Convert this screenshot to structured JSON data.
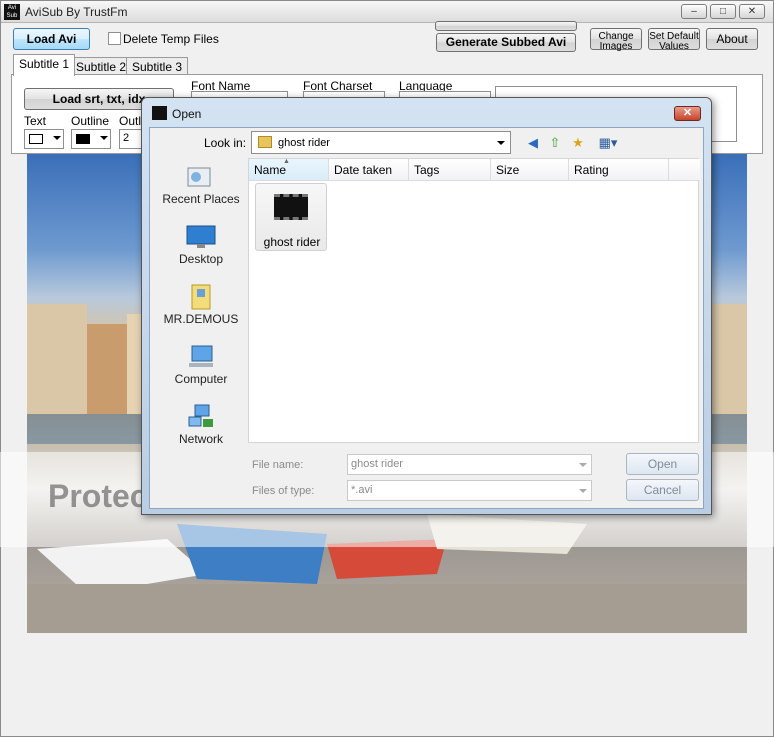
{
  "window": {
    "title": "AviSub By TrustFm",
    "icon_text": "Avi Sub",
    "controls": [
      "minimize",
      "maximize",
      "close"
    ]
  },
  "toolbar": {
    "load_avi": "Load Avi",
    "delete_temp": "Delete Temp Files",
    "delete_temp_checked": false,
    "generate": "Generate Subbed Avi",
    "change_images_1": "Change",
    "change_images_2": "Images",
    "set_default_1": "Set Default",
    "set_default_2": "Values",
    "about": "About"
  },
  "tabs": [
    "Subtitle 1",
    "Subtitle 2",
    "Subtitle 3"
  ],
  "active_tab": 0,
  "subtitle_panel": {
    "load_button": "Load srt, txt, idx",
    "font_name_label": "Font Name",
    "font_charset_label": "Font Charset",
    "language_label": "Language",
    "text_label": "Text",
    "outline_label_1": "Outline",
    "outline_label_2": "Outli",
    "outline_value": "2",
    "text_color": "#ffffff",
    "outline_color": "#000000"
  },
  "watermark": "Protect more of your memories for less!",
  "dialog": {
    "title": "Open",
    "look_in_label": "Look in:",
    "look_in_value": "ghost rider",
    "places": [
      {
        "label": "Recent Places",
        "icon": "recent-places-icon"
      },
      {
        "label": "Desktop",
        "icon": "desktop-icon"
      },
      {
        "label": "MR.DEMOUS",
        "icon": "user-folder-icon"
      },
      {
        "label": "Computer",
        "icon": "computer-icon"
      },
      {
        "label": "Network",
        "icon": "network-icon"
      }
    ],
    "columns": [
      "Name",
      "Date taken",
      "Tags",
      "Size",
      "Rating"
    ],
    "sorted_column": "Name",
    "files": [
      {
        "name": "ghost rider",
        "icon": "video-folder-icon"
      }
    ],
    "file_name_label": "File name:",
    "file_name_value": "ghost rider",
    "file_type_label": "Files of type:",
    "file_type_value": "*.avi",
    "open_button": "Open",
    "cancel_button": "Cancel"
  }
}
